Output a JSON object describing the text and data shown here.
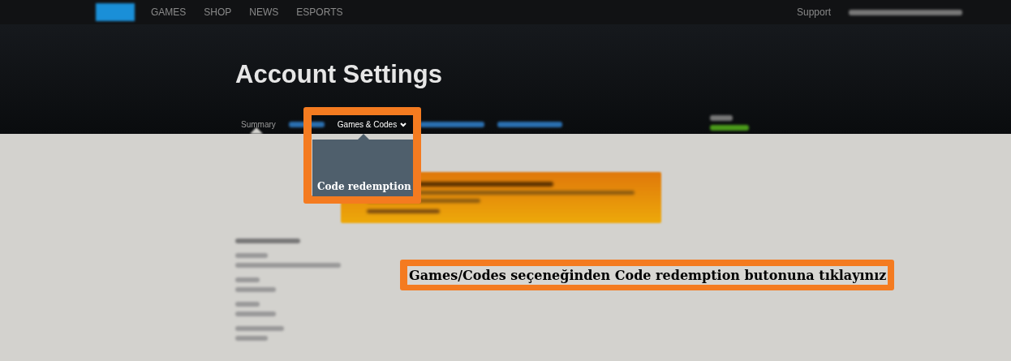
{
  "top_nav": {
    "items": [
      {
        "label": "GAMES"
      },
      {
        "label": "SHOP"
      },
      {
        "label": "NEWS"
      },
      {
        "label": "ESPORTS"
      }
    ],
    "support": "Support"
  },
  "header": {
    "title": "Account Settings"
  },
  "sub_nav": {
    "tabs": [
      {
        "label": "Summary",
        "selected": true,
        "expanded": false
      },
      {
        "label": "Games & Codes",
        "selected": false,
        "expanded": true
      }
    ]
  },
  "dropdown": {
    "items": [
      "Code redemption"
    ]
  },
  "instruction": "Games/Codes seçeneğinden Code redemption butonuna tıklayınız"
}
